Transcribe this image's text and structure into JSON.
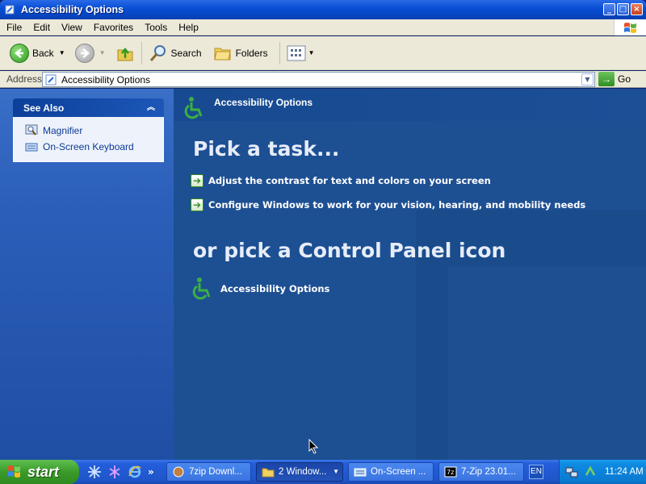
{
  "window": {
    "title": "Accessibility Options",
    "buttons": {
      "minimize": "_",
      "maximize": "□",
      "close": "×"
    }
  },
  "menubar": {
    "items": [
      "File",
      "Edit",
      "View",
      "Favorites",
      "Tools",
      "Help"
    ]
  },
  "toolbar": {
    "back_label": "Back",
    "search_label": "Search",
    "folders_label": "Folders"
  },
  "address": {
    "label": "Address",
    "value": "Accessibility Options",
    "go_label": "Go"
  },
  "see_also": {
    "header": "See Also",
    "items": [
      {
        "label": "Magnifier",
        "icon": "magnifier-icon"
      },
      {
        "label": "On-Screen Keyboard",
        "icon": "keyboard-icon"
      }
    ]
  },
  "content": {
    "category_title": "Accessibility Options",
    "pick_task_heading": "Pick a task...",
    "tasks": [
      "Adjust the contrast for text and colors on your screen",
      "Configure Windows to work for your vision, hearing, and mobility needs"
    ],
    "pick_icon_heading": "or pick a Control Panel icon",
    "icons": [
      {
        "label": "Accessibility Options",
        "icon": "wheelchair-icon"
      }
    ]
  },
  "taskbar": {
    "start_label": "start",
    "quicklaunch_chevron": "»",
    "tasks": [
      {
        "label": "7zip Downl...",
        "active": false
      },
      {
        "label": "2 Window...",
        "active": true
      },
      {
        "label": "On-Screen ...",
        "active": false
      },
      {
        "label": "7-Zip 23.01...",
        "active": false
      }
    ],
    "language": "EN",
    "clock": "11:24 AM"
  },
  "colors": {
    "xp_blue": "#245edb",
    "start_green": "#3a9a2a",
    "content_blue": "#1d4f93",
    "sidebar_link": "#0c3a96"
  }
}
